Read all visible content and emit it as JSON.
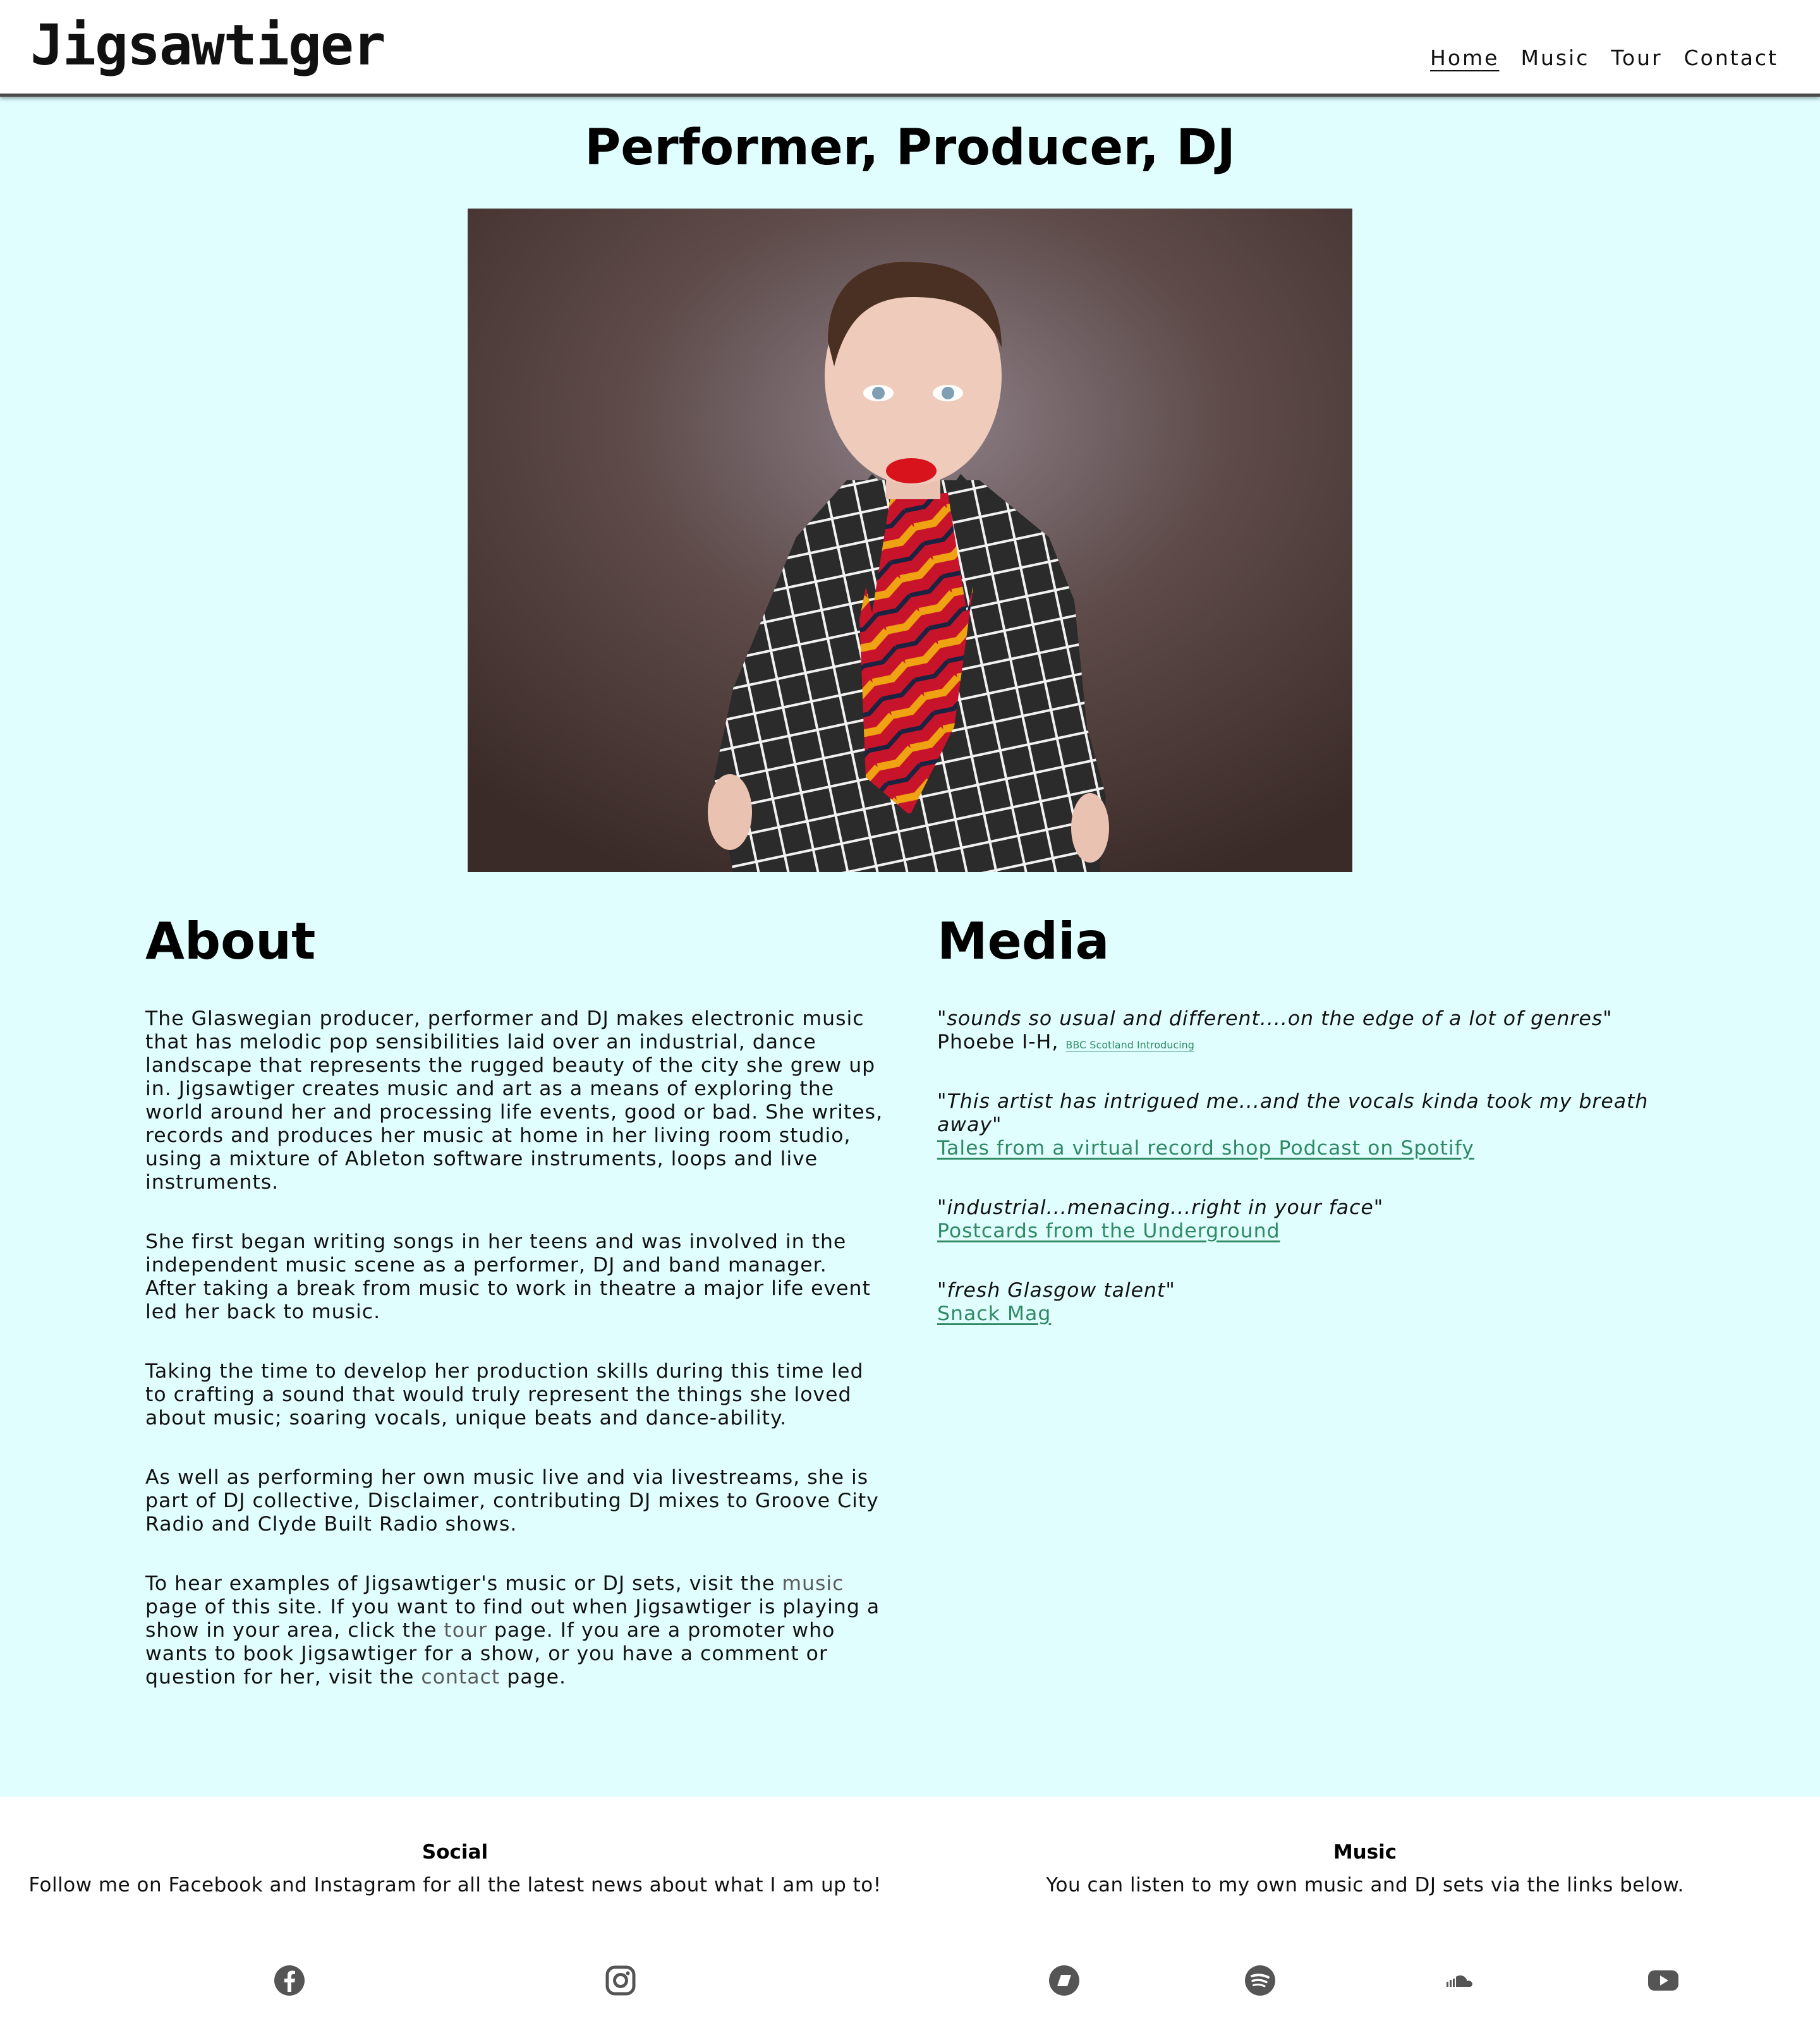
{
  "header": {
    "brand": "Jigsawtiger",
    "nav": [
      {
        "label": "Home",
        "active": true
      },
      {
        "label": "Music",
        "active": false
      },
      {
        "label": "Tour",
        "active": false
      },
      {
        "label": "Contact",
        "active": false
      }
    ]
  },
  "hero": {
    "title": "Performer, Producer, DJ"
  },
  "about": {
    "heading": "About",
    "p1": "The Glaswegian producer, performer and DJ makes electronic music that has melodic pop sensibilities laid over an industrial, dance landscape that represents the rugged beauty of the city she grew up in. Jigsawtiger creates music and art as a means of exploring the world around her and processing life events, good or bad. She writes, records and produces her music at home in her living room studio, using a mixture of Ableton software instruments, loops and live instruments.",
    "p2": "She first began writing songs in her teens and was involved in the independent music scene as a performer, DJ and band manager. After taking a break from music to work in theatre a major life event led her back to music.",
    "p3": "Taking the time to develop her production skills during this time led to crafting a sound that would truly represent the things she loved about music; soaring vocals, unique beats and dance-ability.",
    "p4": "As well as performing her own music live and via livestreams, she is part of DJ collective, Disclaimer, contributing DJ mixes to Groove City Radio and Clyde Built Radio shows.",
    "p5_a": "To hear examples of Jigsawtiger's music or DJ sets, visit the ",
    "p5_link1": "music",
    "p5_b": " page of this site. If you want to find out when Jigsawtiger is playing a show in your area, click the ",
    "p5_link2": "tour",
    "p5_c": " page. If you are a promoter who wants to book Jigsawtiger for a show, or you have a comment or question for her, visit the ",
    "p5_link3": "contact",
    "p5_d": " page."
  },
  "media": {
    "heading": "Media",
    "quotes": [
      {
        "quote": "\"sounds so usual and different....on the edge of a lot of genres\"",
        "prefix": "Phoebe I-H, ",
        "link": "BBC Scotland Introducing"
      },
      {
        "quote": "\"This artist has intrigued me...and the vocals kinda took my breath away\"",
        "prefix": "",
        "link": "Tales from a virtual record shop Podcast on Spotify"
      },
      {
        "quote": "\"industrial...menacing...right in your face\"",
        "prefix": "",
        "link": "Postcards from the Underground"
      },
      {
        "quote": "\"fresh Glasgow talent\"",
        "prefix": "",
        "link": "Snack Mag"
      }
    ]
  },
  "footer": {
    "social": {
      "heading": "Social",
      "text": "Follow me on Facebook and Instagram for all the latest news about what I am up to!",
      "icons": [
        "facebook-icon",
        "instagram-icon"
      ]
    },
    "music": {
      "heading": "Music",
      "text": "You can listen to my own music and DJ sets via the links below.",
      "icons": [
        "bandcamp-icon",
        "spotify-icon",
        "soundcloud-icon",
        "youtube-icon"
      ]
    }
  },
  "colors": {
    "page_bg": "#e0fefe",
    "link_green": "#2f8a64",
    "icon_gray": "#555555"
  }
}
